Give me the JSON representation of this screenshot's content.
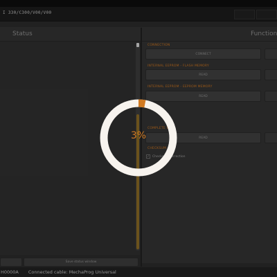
{
  "titlebar": {
    "title": "I 330/C300/V00/V00"
  },
  "panels": {
    "status_label": "Status",
    "functions_label": "Functions"
  },
  "sections": {
    "connection": {
      "title": "CONNECTION",
      "button": "CONNECT"
    },
    "flash": {
      "title": "INTERNAL EEPROM - FLASH MEMORY",
      "button": "READ"
    },
    "eeprom": {
      "title": "INTERNAL EEPROM - EEPROM MEMORY",
      "button": "READ"
    },
    "complete": {
      "title": "COMPLETE UI",
      "button": "READ"
    },
    "checksum": {
      "title": "CHECKSUM",
      "checkbox_label": "Checksum correction",
      "checked": true
    }
  },
  "bottom": {
    "save_button": "Save status window"
  },
  "statusbar": {
    "device": "H0000A",
    "cable": "Connected cable: MechaProg Universal"
  },
  "progress": {
    "percent": 3,
    "label": "3%"
  },
  "colors": {
    "accent": "#d17a22",
    "ring": "#f7f3ee"
  }
}
